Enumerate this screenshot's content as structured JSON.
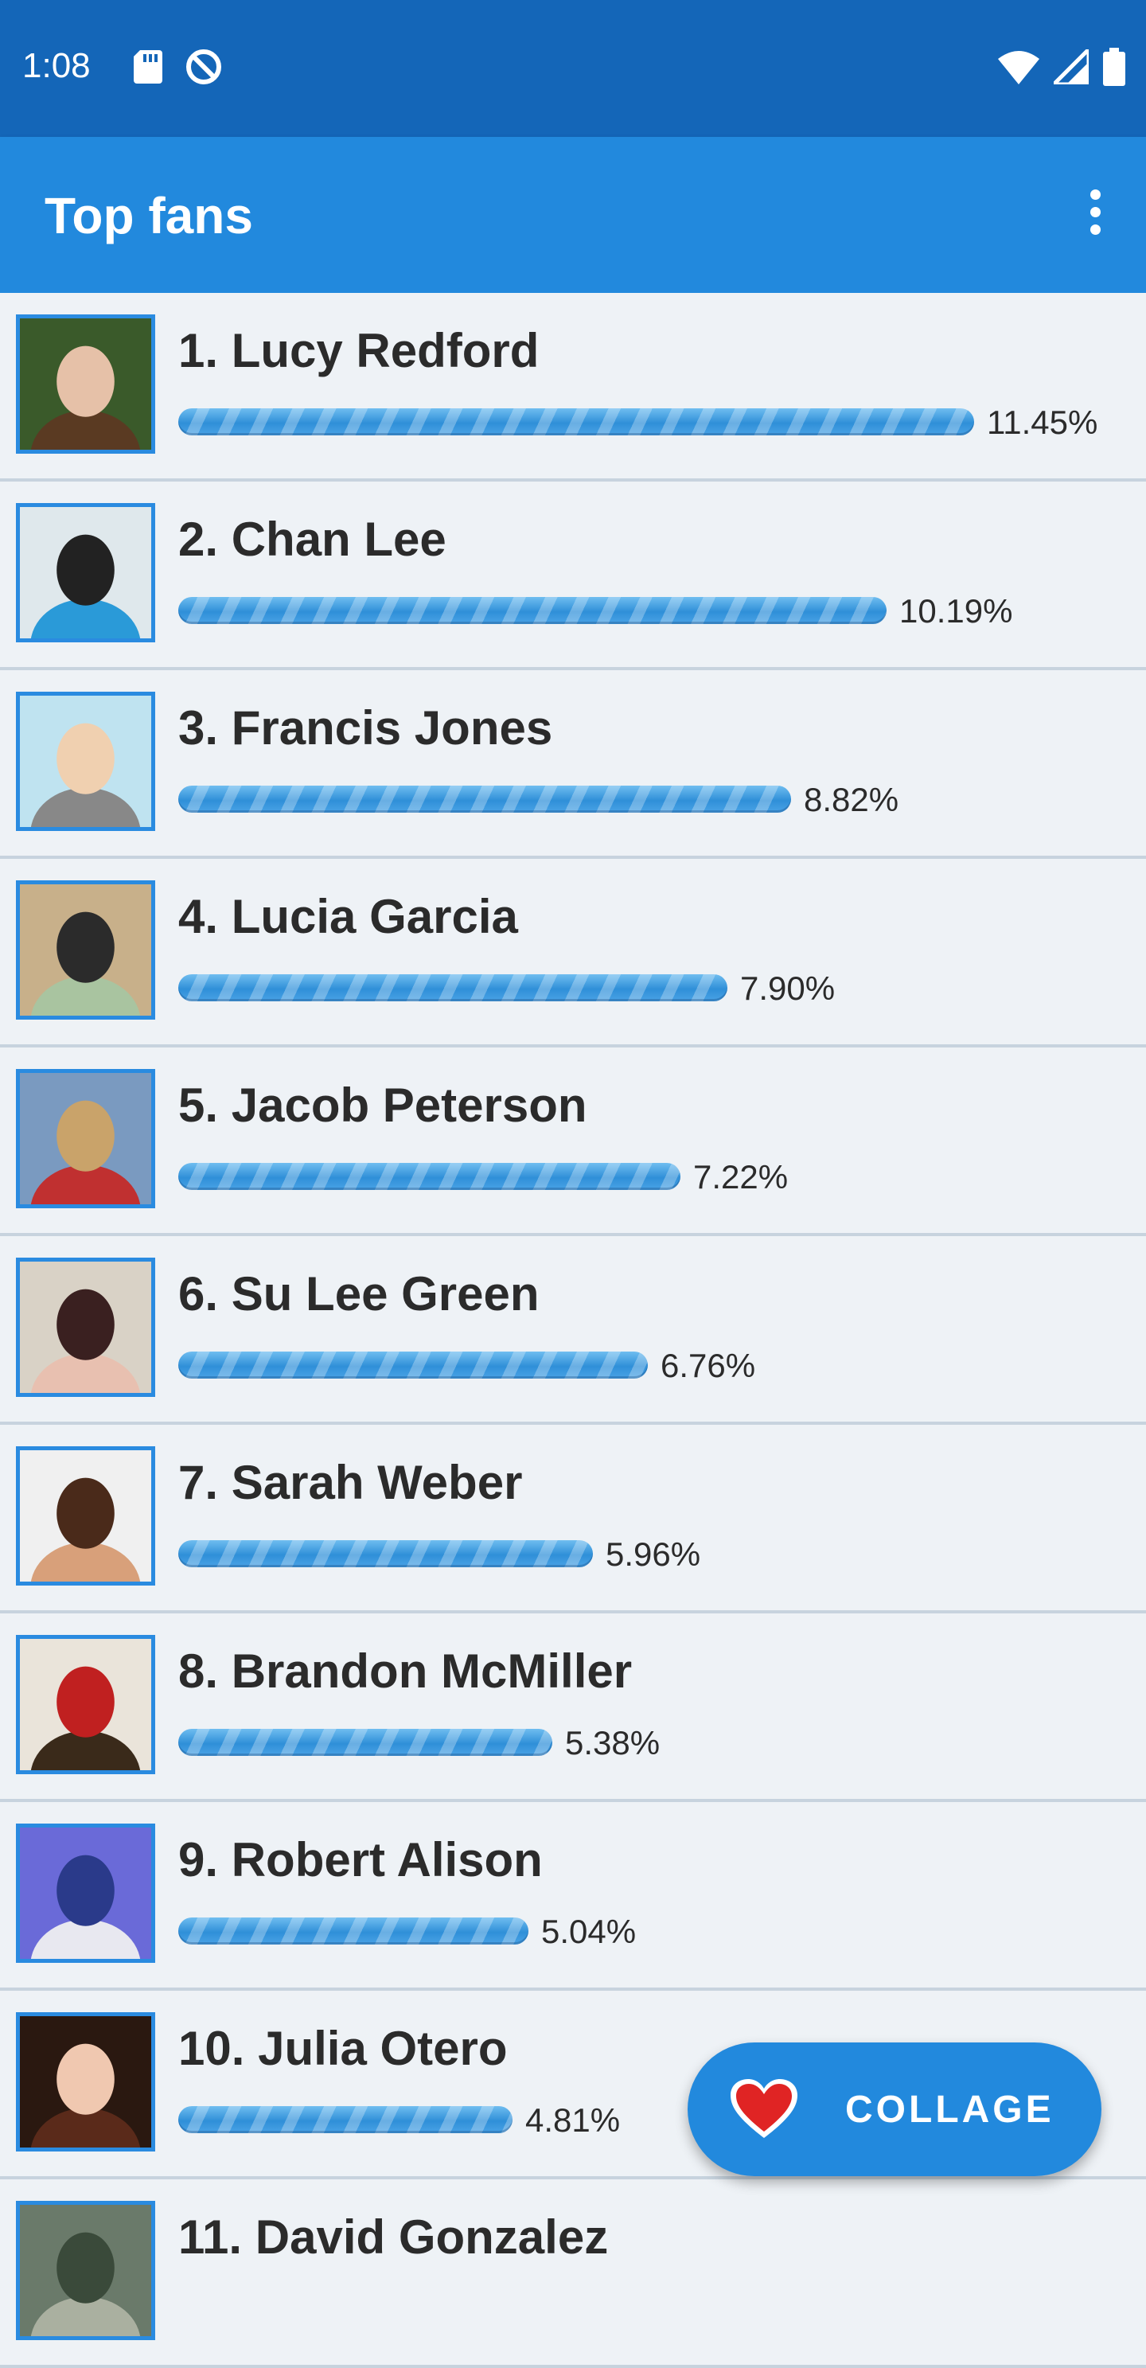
{
  "status_bar": {
    "time": "1:08",
    "icons_left": [
      "sd-card-icon",
      "no-disturb-icon"
    ],
    "icons_right": [
      "wifi-icon",
      "cell-signal-icon",
      "battery-icon"
    ]
  },
  "app_bar": {
    "title": "Top fans",
    "menu_icon": "more-vert-icon"
  },
  "fans": [
    {
      "name": "1. Lucy Redford",
      "percent": "11.45%",
      "share": 11.45
    },
    {
      "name": "2. Chan Lee",
      "percent": "10.19%",
      "share": 10.19
    },
    {
      "name": "3. Francis Jones",
      "percent": "8.82%",
      "share": 8.82
    },
    {
      "name": "4. Lucia Garcia",
      "percent": "7.90%",
      "share": 7.9
    },
    {
      "name": "5. Jacob Peterson",
      "percent": "7.22%",
      "share": 7.22
    },
    {
      "name": "6. Su Lee Green",
      "percent": "6.76%",
      "share": 6.76
    },
    {
      "name": "7. Sarah Weber",
      "percent": "5.96%",
      "share": 5.96
    },
    {
      "name": "8. Brandon McMiller",
      "percent": "5.38%",
      "share": 5.38
    },
    {
      "name": "9. Robert Alison",
      "percent": "5.04%",
      "share": 5.04
    },
    {
      "name": "10. Julia Otero",
      "percent": "4.81%",
      "share": 4.81
    },
    {
      "name": "11. David Gonzalez",
      "percent": "",
      "share": 0
    }
  ],
  "fab": {
    "label": "COLLAGE",
    "icon": "heart-icon"
  },
  "colors": {
    "status_bar": "#1466b8",
    "app_bar": "#2289dd",
    "accent": "#2a8be0",
    "heart": "#e02424",
    "background": "#eef2f6"
  }
}
